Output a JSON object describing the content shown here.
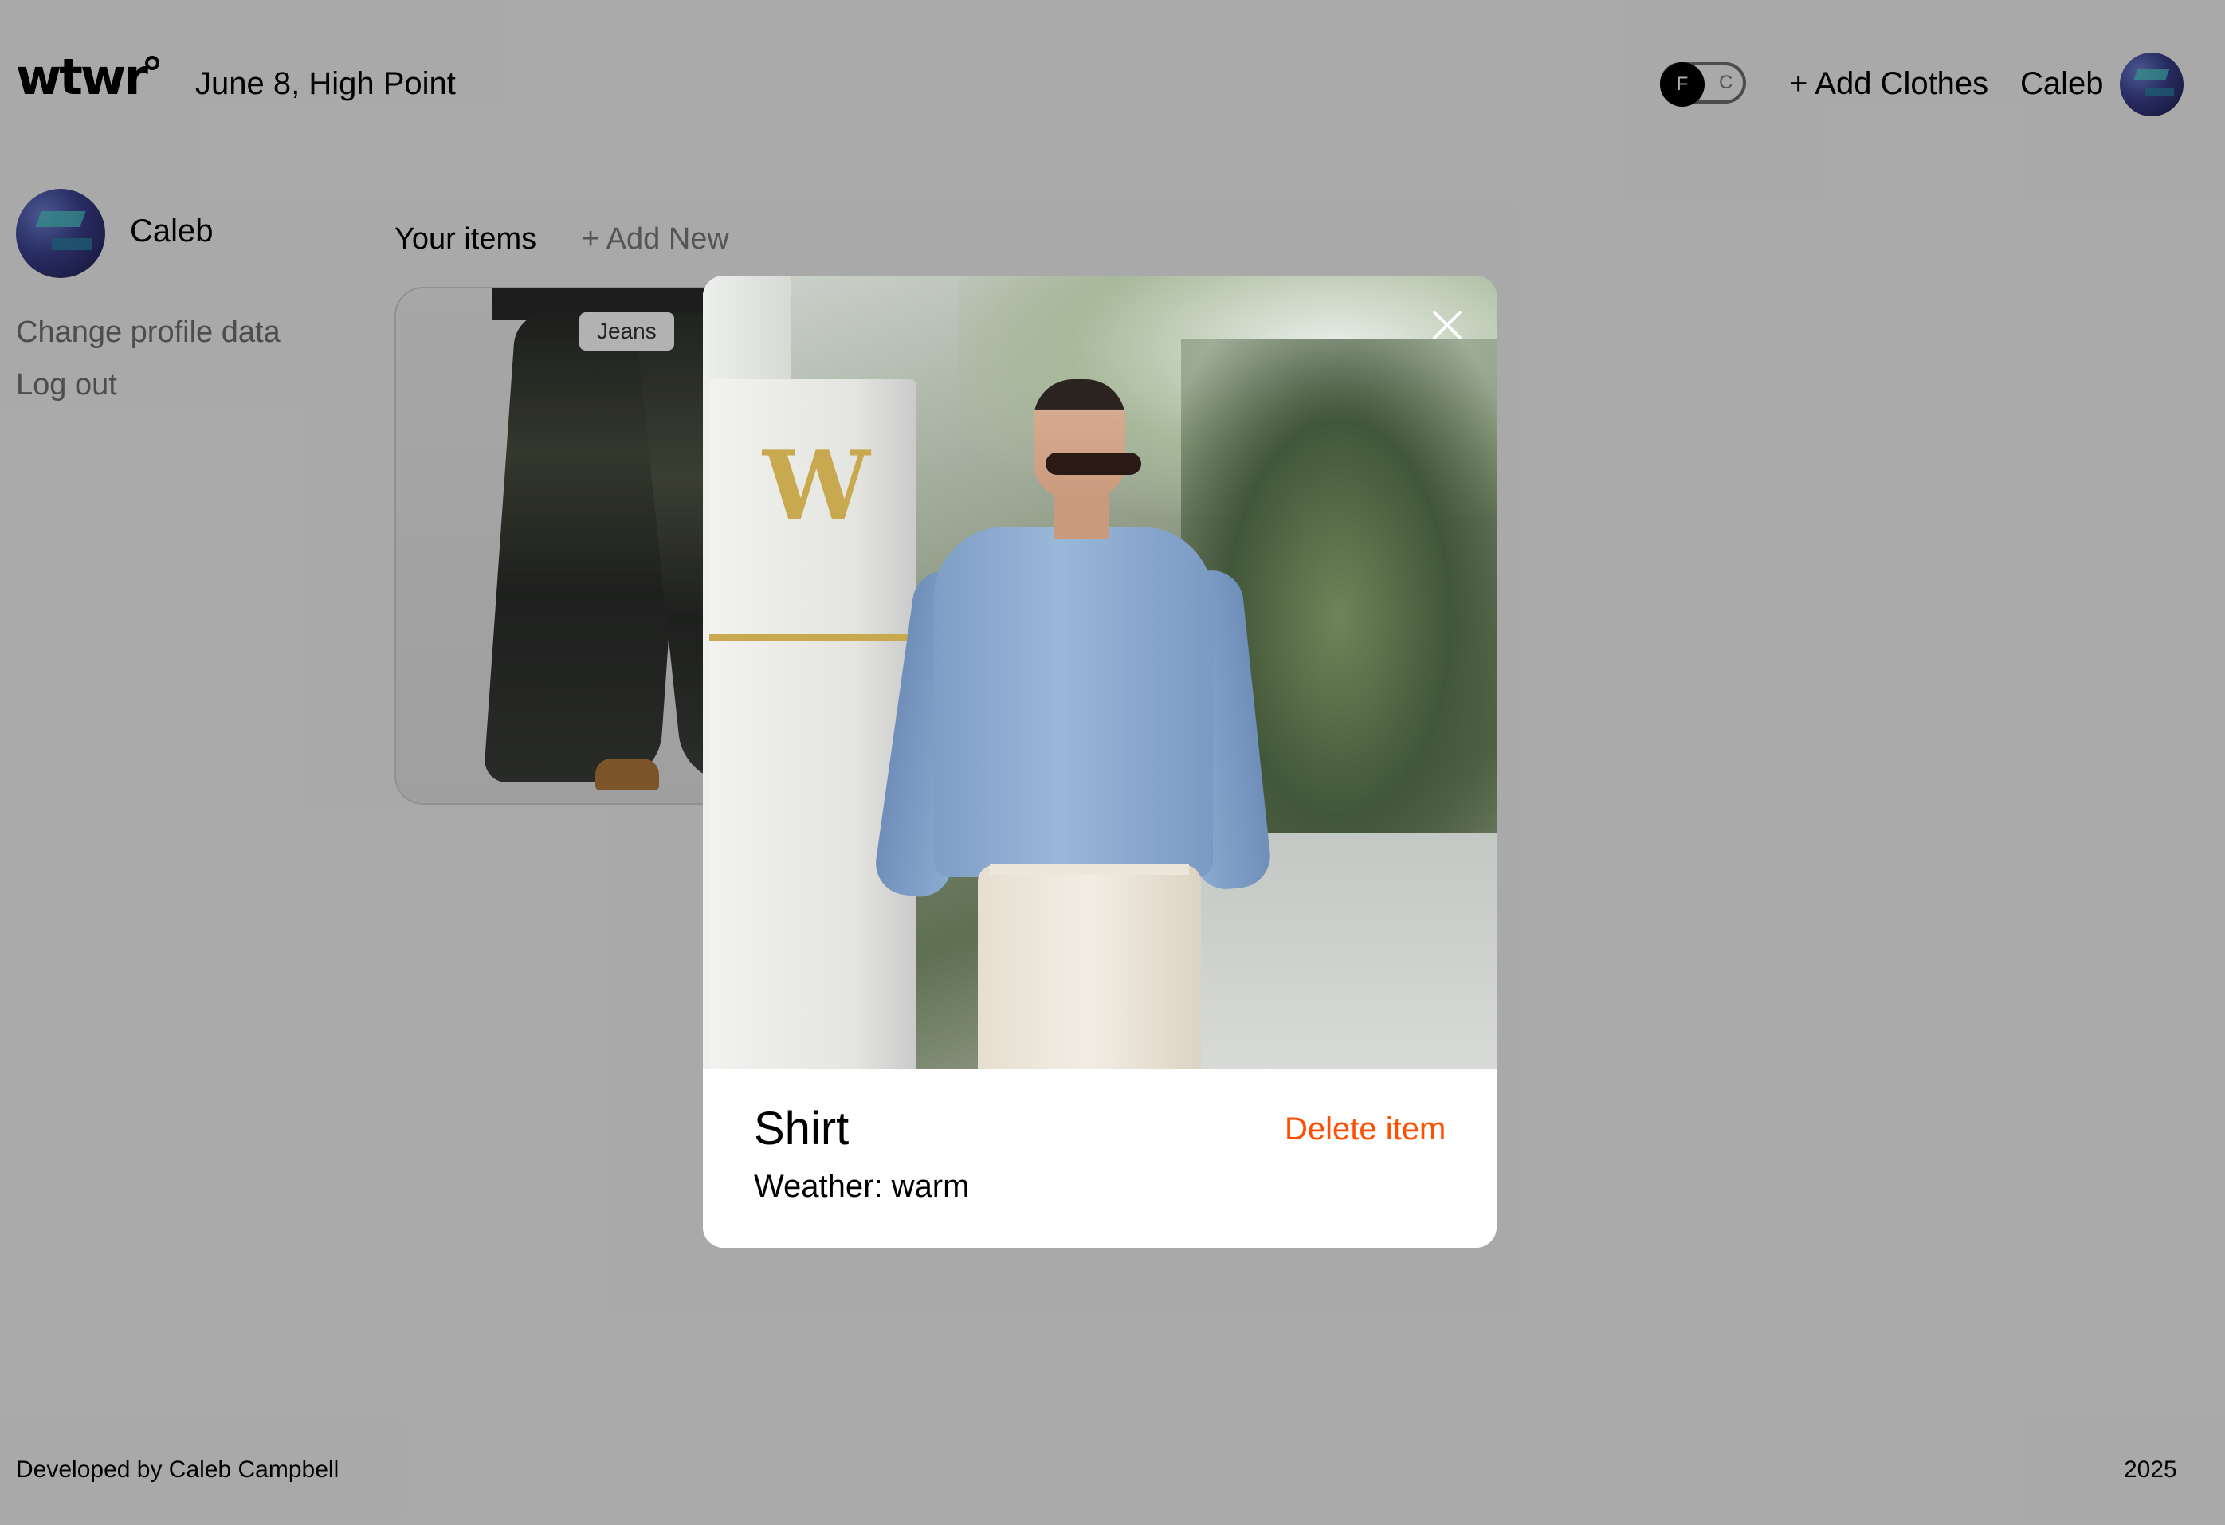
{
  "header": {
    "logo": "wtwr",
    "date_location": "June 8, High Point",
    "temp_toggle": {
      "active": "F",
      "inactive": "C"
    },
    "add_clothes_label": "+ Add Clothes",
    "username": "Caleb",
    "avatar_icon": "user-avatar"
  },
  "sidebar": {
    "username": "Caleb",
    "change_profile_label": "Change profile data",
    "log_out_label": "Log out"
  },
  "items_section": {
    "title": "Your items",
    "add_new_label": "+ Add New",
    "cards": [
      {
        "name": "Jeans"
      }
    ]
  },
  "modal": {
    "item_name": "Shirt",
    "weather_label": "Weather: warm",
    "delete_label": "Delete item",
    "close_icon": "close-icon"
  },
  "footer": {
    "credit": "Developed by Caleb Campbell",
    "year": "2025"
  },
  "colors": {
    "page_background": "#f3f3f3",
    "overlay": "rgba(0,0,0,0.3)",
    "delete_accent": "#ff4f00",
    "sidebar_link": "#6f6f6f"
  }
}
